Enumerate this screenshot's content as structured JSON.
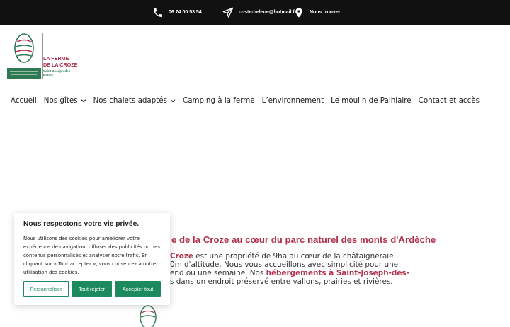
{
  "topbar": {
    "phone": "06 74 00 53 54",
    "email": "coste-helene@hotmail.fr",
    "location": "Nous trouver",
    "icons": [
      "phone-icon",
      "paper-plane-icon",
      "map-pin-icon"
    ]
  },
  "logo": {
    "line1": "LA FERME",
    "line2": "DE LA CROZE",
    "line3": "Saint-Joseph-des-Bancs"
  },
  "nav": {
    "items": [
      {
        "label": "Accueil",
        "dropdown": false
      },
      {
        "label": "Nos gîtes",
        "dropdown": true
      },
      {
        "label": "Nos chalets adaptés",
        "dropdown": true
      },
      {
        "label": "Camping à la ferme",
        "dropdown": false
      },
      {
        "label": "L’environnement",
        "dropdown": false
      },
      {
        "label": "Le moulin de Palhiaire",
        "dropdown": false
      },
      {
        "label": "Contact et accès",
        "dropdown": false
      }
    ]
  },
  "content": {
    "headline": "e de la Croze au cœur du parc naturel des monts d'Ardèche",
    "p_line1_bold": "Croze",
    "p_line1_rest": " est une propriété de 9ha au cœur de la châtaigneraie",
    "p_line2": "0m d'altitude. Nous vous accueillons avec simplicité pour une",
    "p_line3_start": "end ou une semaine. Nos ",
    "p_line3_bold": "hébergements à Saint-Joseph-des-",
    "p_line4": "s dans un endroit préservé entre vallons, prairies et rivières."
  },
  "cookie": {
    "title": "Nous respectons votre vie privée.",
    "text": "Nous utilisons des cookies pour améliorer votre expérience de navigation, diffuser des publicités ou des contenus personnalisés et analyser notre trafic. En cliquant sur « Tout accepter », vous consentez à notre utilisation des cookies.",
    "btn_customize": "Personnaliser",
    "btn_reject": "Tout rejeter",
    "btn_accept": "Accepter tout"
  },
  "colors": {
    "brand_red": "#b0324b",
    "brand_green": "#1d8a5e",
    "topbar_bg": "#111111"
  }
}
